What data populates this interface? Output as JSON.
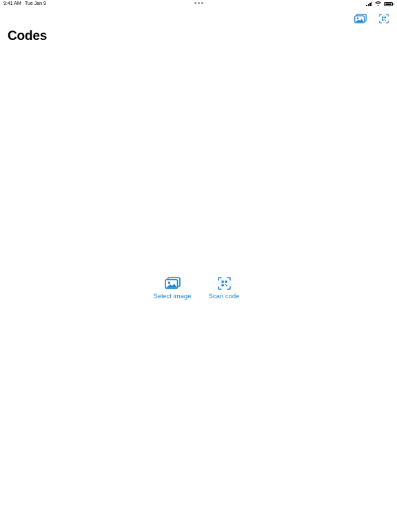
{
  "status_bar": {
    "time": "9:41 AM",
    "date": "Tue Jan 9",
    "icons": [
      "signal-icon",
      "wifi-icon",
      "battery-icon"
    ]
  },
  "nav": {
    "title": "Codes",
    "buttons": [
      {
        "icon": "photo-library-icon"
      },
      {
        "icon": "qr-scan-icon"
      }
    ]
  },
  "empty_state": {
    "actions": [
      {
        "label": "Select image",
        "icon": "photo-library-icon"
      },
      {
        "label": "Scan code",
        "icon": "qr-scan-icon"
      }
    ]
  },
  "colors": {
    "accent": "#1a84d6",
    "text": "#000000",
    "background": "#ffffff"
  }
}
